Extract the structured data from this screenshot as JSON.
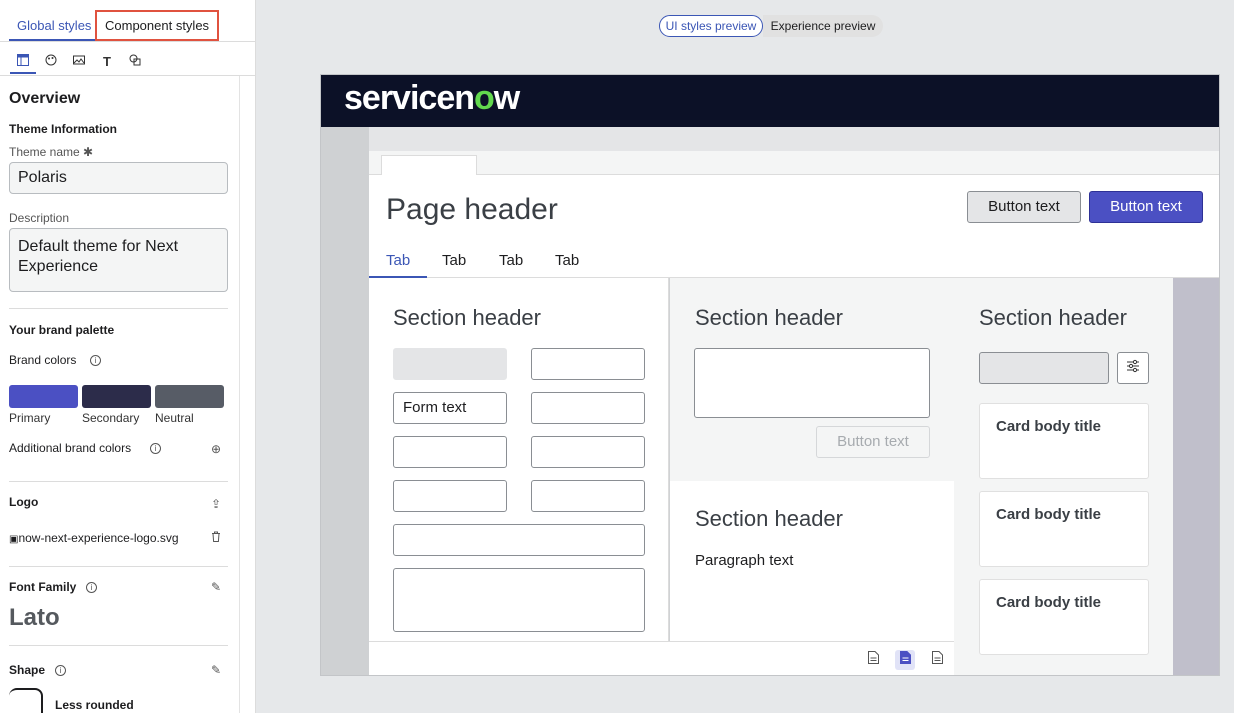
{
  "left_panel": {
    "tabs": [
      "Global styles",
      "Component styles"
    ],
    "icons": [
      "layout-icon",
      "palette-icon",
      "image-icon",
      "text-icon",
      "shapes-icon"
    ],
    "overview_title": "Overview",
    "theme_info_label": "Theme Information",
    "theme_name_label": "Theme name",
    "theme_name_value": "Polaris",
    "description_label": "Description",
    "description_value": "Default theme for Next Experience",
    "brand_palette_label": "Your brand palette",
    "brand_colors_label": "Brand colors",
    "swatches": [
      {
        "label": "Primary",
        "color": "#4b50c3"
      },
      {
        "label": "Secondary",
        "color": "#2c2c4a"
      },
      {
        "label": "Neutral",
        "color": "#575c66"
      }
    ],
    "additional_brand_colors_label": "Additional brand colors",
    "logo_label": "Logo",
    "logo_file": "now-next-experience-logo.svg",
    "font_family_label": "Font Family",
    "font_family_value": "Lato",
    "shape_label": "Shape",
    "shape_value": "Less rounded"
  },
  "preview": {
    "toggle": {
      "ui_styles": "UI styles preview",
      "experience": "Experience preview"
    },
    "logo_text_1": "servicen",
    "logo_text_o": "o",
    "logo_text_2": "w",
    "page_header": "Page header",
    "button_secondary": "Button text",
    "button_primary": "Button text",
    "tabs": [
      "Tab",
      "Tab",
      "Tab",
      "Tab"
    ],
    "section_header": "Section header",
    "form_text": "Form text",
    "button_disabled": "Button text",
    "paragraph_text": "Paragraph text",
    "card_title": "Card body title"
  }
}
